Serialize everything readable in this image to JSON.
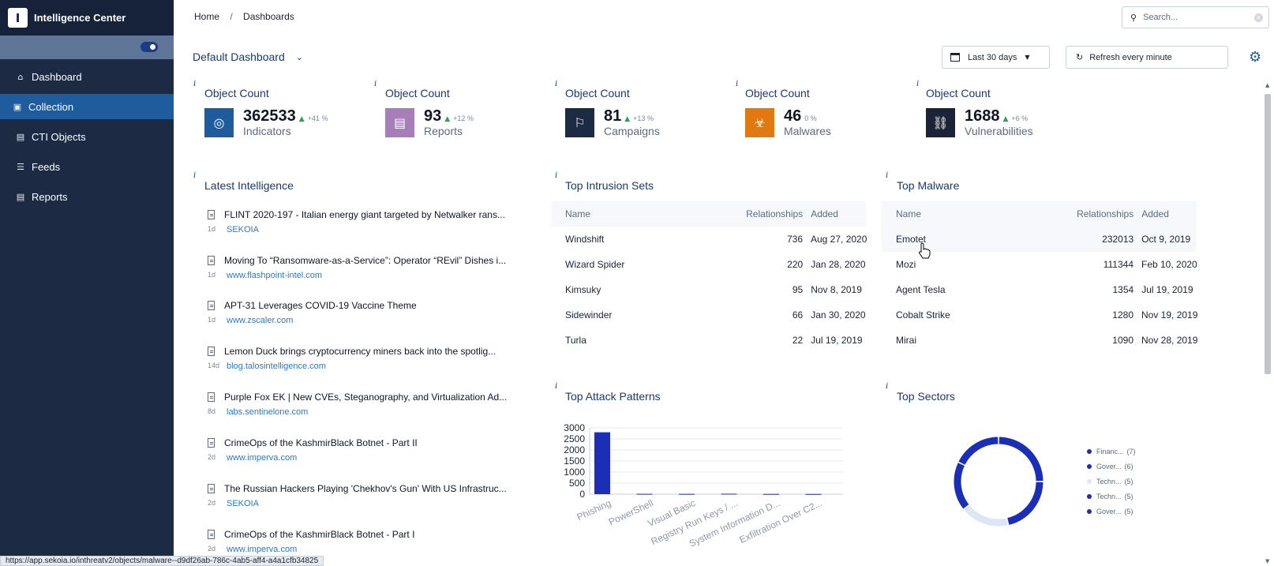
{
  "app": {
    "logo_letter": "I",
    "name": "Intelligence Center"
  },
  "sidebar": {
    "items": [
      {
        "label": "Dashboard",
        "icon": "home-icon"
      },
      {
        "label": "Collection",
        "icon": "collection-icon",
        "active": true
      },
      {
        "label": "CTI Objects",
        "icon": "document-icon"
      },
      {
        "label": "Feeds",
        "icon": "list-icon"
      },
      {
        "label": "Reports",
        "icon": "document-icon"
      }
    ]
  },
  "breadcrumb": {
    "home": "Home",
    "sep": "/",
    "current": "Dashboards"
  },
  "search": {
    "placeholder": "Search..."
  },
  "dashboard": {
    "title": "Default Dashboard"
  },
  "date_range": {
    "label": "Last 30 days"
  },
  "refresh": {
    "label": "Refresh every minute"
  },
  "info_marker": "i",
  "stat_cards": [
    {
      "title": "Object Count",
      "value": "362533",
      "change": "+41 %",
      "label": "Indicators",
      "color": "#1f5c9e",
      "icon": "fingerprint-icon"
    },
    {
      "title": "Object Count",
      "value": "93",
      "change": "+12 %",
      "label": "Reports",
      "color": "#a67fb8",
      "icon": "report-icon"
    },
    {
      "title": "Object Count",
      "value": "81",
      "change": "+13 %",
      "label": "Campaigns",
      "color": "#1c2a44",
      "icon": "campaign-icon"
    },
    {
      "title": "Object Count",
      "value": "46",
      "change": "0 %",
      "label": "Malwares",
      "color": "#e07a10",
      "icon": "bug-icon"
    },
    {
      "title": "Object Count",
      "value": "1688",
      "change": "+6 %",
      "label": "Vulnerabilities",
      "color": "#1c2238",
      "icon": "vulnerability-icon"
    }
  ],
  "latest_intelligence": {
    "title": "Latest Intelligence",
    "items": [
      {
        "title": "FLINT 2020-197 - Italian energy giant targeted by Netwalker rans...",
        "age": "1d",
        "source": "SEKOIA"
      },
      {
        "title": "Moving To “Ransomware-as-a-Service”: Operator “REvil” Dishes i...",
        "age": "1d",
        "source": "www.flashpoint-intel.com"
      },
      {
        "title": "APT-31 Leverages COVID-19 Vaccine Theme",
        "age": "1d",
        "source": "www.zscaler.com"
      },
      {
        "title": "Lemon Duck brings cryptocurrency miners back into the spotlig...",
        "age": "14d",
        "source": "blog.talosintelligence.com"
      },
      {
        "title": "Purple Fox EK | New CVEs, Steganography, and Virtualization Ad...",
        "age": "8d",
        "source": "labs.sentinelone.com"
      },
      {
        "title": "CrimeOps of the KashmirBlack Botnet - Part II",
        "age": "2d",
        "source": "www.imperva.com"
      },
      {
        "title": "The Russian Hackers Playing 'Chekhov's Gun' With US Infrastruc...",
        "age": "2d",
        "source": "SEKOIA"
      },
      {
        "title": "CrimeOps of the KashmirBlack Botnet - Part I",
        "age": "2d",
        "source": "www.imperva.com"
      }
    ]
  },
  "top_intrusion_sets": {
    "title": "Top Intrusion Sets",
    "columns": [
      "Name",
      "Relationships",
      "Added"
    ],
    "rows": [
      {
        "name": "Windshift",
        "rel": "736",
        "added": "Aug 27, 2020"
      },
      {
        "name": "Wizard Spider",
        "rel": "220",
        "added": "Jan 28, 2020"
      },
      {
        "name": "Kimsuky",
        "rel": "95",
        "added": "Nov 8, 2019"
      },
      {
        "name": "Sidewinder",
        "rel": "66",
        "added": "Jan 30, 2020"
      },
      {
        "name": "Turla",
        "rel": "22",
        "added": "Jul 19, 2019"
      }
    ]
  },
  "top_malware": {
    "title": "Top Malware",
    "columns": [
      "Name",
      "Relationships",
      "Added"
    ],
    "rows": [
      {
        "name": "Emotet",
        "rel": "232013",
        "added": "Oct 9, 2019"
      },
      {
        "name": "Mozi",
        "rel": "111344",
        "added": "Feb 10, 2020"
      },
      {
        "name": "Agent Tesla",
        "rel": "1354",
        "added": "Jul 19, 2019"
      },
      {
        "name": "Cobalt Strike",
        "rel": "1280",
        "added": "Nov 19, 2019"
      },
      {
        "name": "Mirai",
        "rel": "1090",
        "added": "Nov 28, 2019"
      }
    ]
  },
  "top_attack_patterns": {
    "title": "Top Attack Patterns"
  },
  "top_sectors": {
    "title": "Top Sectors"
  },
  "chart_data": [
    {
      "type": "bar",
      "categories": [
        "Phishing",
        "PowerShell",
        "Visual Basic",
        "Registry Run Keys / ...",
        "System Information D...",
        "Exfiltration Over C2..."
      ],
      "values": [
        2800,
        15,
        12,
        20,
        10,
        8
      ],
      "yticks": [
        0,
        500,
        1000,
        1500,
        2000,
        2500,
        3000
      ],
      "ylim": [
        0,
        3000
      ],
      "color": "#1a2fb5"
    },
    {
      "type": "pie",
      "categories": [
        "Financ...",
        "Gover...",
        "Techn...",
        "Techn...",
        "Gover..."
      ],
      "values": [
        7,
        6,
        5,
        5,
        5
      ],
      "colors": [
        "#1a2fb5",
        "#1a2fb5",
        "#dbe6f7",
        "#1a2fb5",
        "#1a2fb5"
      ]
    }
  ],
  "status_url": "https://app.sekoia.io/inthreatv2/objects/malware--d9df26ab-786c-4ab5-aff4-a4a1cfb34825"
}
